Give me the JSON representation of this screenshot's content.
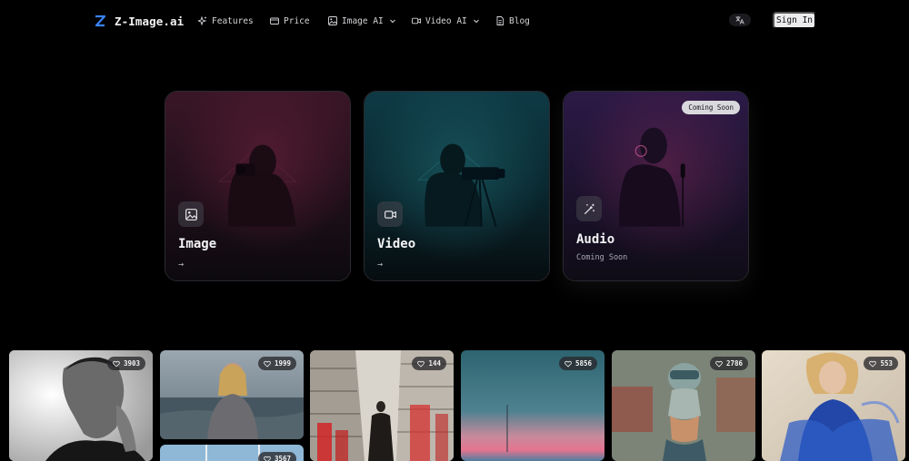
{
  "brand": {
    "name": "Z-Image.ai",
    "logo_icon": "z-logo-icon",
    "accent": "#3b82f6"
  },
  "nav": {
    "items": [
      {
        "label": "Features",
        "icon": "sparkles-icon"
      },
      {
        "label": "Price",
        "icon": "credit-card-icon"
      },
      {
        "label": "Image AI",
        "icon": "image-icon",
        "dropdown": true
      },
      {
        "label": "Video AI",
        "icon": "video-icon",
        "dropdown": true
      },
      {
        "label": "Blog",
        "icon": "document-icon"
      }
    ],
    "language_icon": "translate-icon",
    "sign_in_label": "Sign In"
  },
  "categories": [
    {
      "title": "Image",
      "icon": "image-icon",
      "arrow": "→"
    },
    {
      "title": "Video",
      "icon": "video-icon",
      "arrow": "→"
    },
    {
      "title": "Audio",
      "icon": "magic-wand-icon",
      "subtitle": "Coming Soon",
      "badge": "Coming Soon"
    }
  ],
  "gallery": [
    {
      "likes": "3903",
      "subject": "man-portrait"
    },
    {
      "likes": "1999",
      "subject": "woman-seaside"
    },
    {
      "likes": "3567",
      "subject": "sky-scene"
    },
    {
      "likes": "144",
      "subject": "street-scene"
    },
    {
      "likes": "5856",
      "subject": "sunset-sea"
    },
    {
      "likes": "2786",
      "subject": "robot-woman"
    },
    {
      "likes": "553",
      "subject": "woman-blue-dress"
    }
  ]
}
